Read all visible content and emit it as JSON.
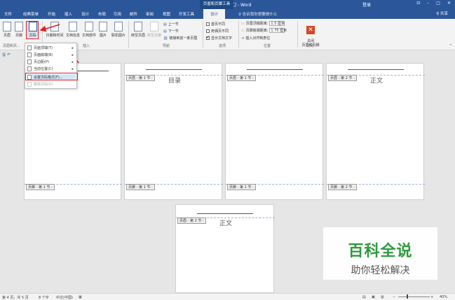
{
  "window": {
    "title": "文档4 [兼容模式] - Word",
    "context_band": "页眉和页脚工具",
    "login": "登录",
    "controls": [
      "⊡",
      "–",
      "□",
      "✕"
    ]
  },
  "tabs": [
    "文件",
    "经典菜单",
    "开始",
    "插入",
    "设计",
    "布局",
    "引用",
    "邮件",
    "审阅",
    "视图",
    "开发工具",
    "设计"
  ],
  "active_tab_index": 11,
  "tellme": "♀ 告诉我你想要做什么",
  "share": "♀ 共享",
  "ribbon": {
    "header_btn": "页眉",
    "footer_btn": "页脚",
    "pagenum_btn": "页码",
    "datetime_btn": "日期和时间",
    "docinfo_btn": "文档信息",
    "docparts_btn": "文档部件",
    "picture_btn": "图片",
    "online_pic_btn": "联机图片",
    "goto_header_btn": "转至页眉",
    "goto_footer_btn": "转至页脚",
    "prev_section": "上一节",
    "next_section": "下一节",
    "link_prev": "链接到前一条页眉",
    "group_hf": "页眉和页...",
    "group_insert": "插入",
    "group_nav": "导航",
    "opt_first_page": "首页不同",
    "opt_odd_even": "奇偶页不同",
    "opt_show_text": "显示文档文字",
    "group_options": "选项",
    "header_top_label": "页眉顶端距离:",
    "header_top_value": "1.5 厘米",
    "footer_bottom_label": "页脚底端距离:",
    "footer_bottom_value": "1.75 厘米",
    "insert_align_tab": "插入对齐制表位",
    "group_position": "位置",
    "close_btn": "关闭\n页眉和页脚",
    "group_close": "关闭"
  },
  "dropdown": {
    "items": [
      {
        "label": "页面顶端(T)",
        "submenu": true,
        "disabled": false
      },
      {
        "label": "页面底端(B)",
        "submenu": true,
        "disabled": false
      },
      {
        "label": "页边距(P)",
        "submenu": true,
        "disabled": false
      },
      {
        "label": "当前位置(C)",
        "submenu": true,
        "disabled": false
      },
      {
        "label": "设置页码格式(F)...",
        "submenu": false,
        "disabled": false
      },
      {
        "label": "删除页码(R)",
        "submenu": false,
        "disabled": true
      }
    ]
  },
  "pages": [
    {
      "header_tag": "",
      "body_text": "",
      "footer_tag": "页脚 - 第 1 节 -"
    },
    {
      "header_tag": "页眉 - 第 1 节 -",
      "body_text": "目录",
      "footer_tag": "页脚 - 第 1 节 -"
    },
    {
      "header_tag": "页眉 - 第 1 节 -",
      "body_text": "",
      "footer_tag": "页脚 - 第 1 节 -"
    },
    {
      "header_tag": "页眉 - 第 2 节 -",
      "body_text": "正文",
      "footer_tag": "页脚 - 第 2 节 -"
    },
    {
      "header_tag": "页眉 - 第 2 节 -",
      "body_text": "正文",
      "footer_tag": ""
    }
  ],
  "statusbar": {
    "page_info": "第 4 页，共 5 页",
    "word_count": "8 个字",
    "language": "中文(中国)",
    "zoom": "40%"
  },
  "watermark": {
    "title": "百科全说",
    "subtitle": "助你轻松解决"
  },
  "colors": {
    "accent": "#2b579a",
    "highlight": "#e02020",
    "watermark_green": "#2e9a3f"
  }
}
